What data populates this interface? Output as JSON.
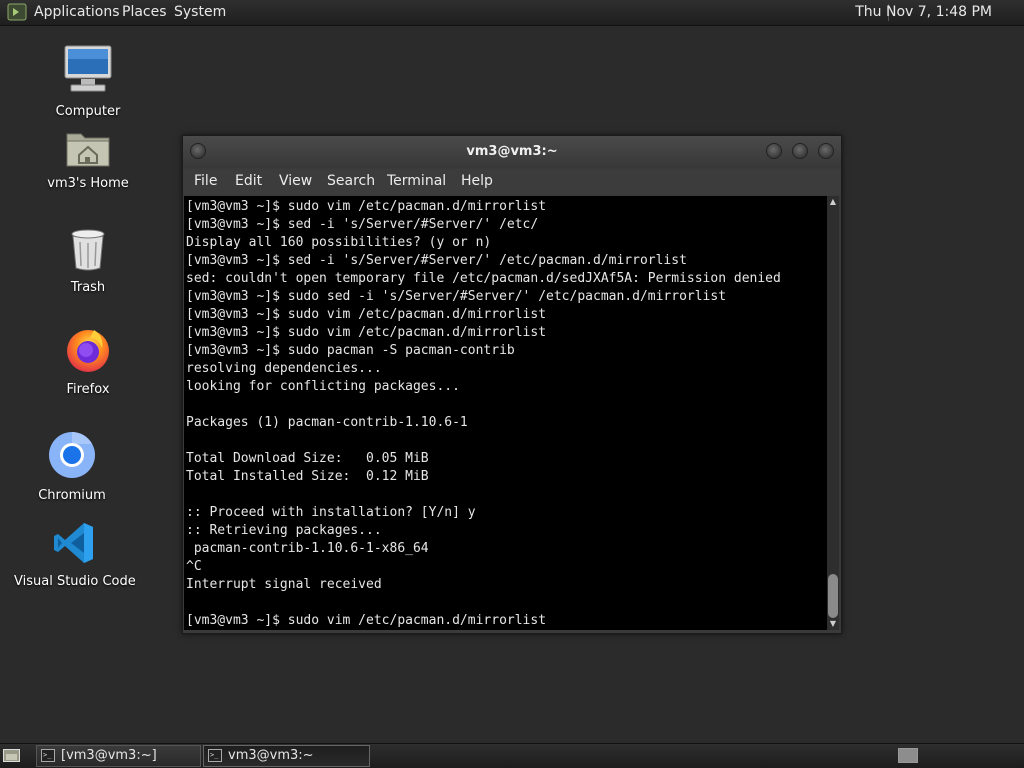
{
  "top_panel": {
    "menus": [
      "Applications",
      "Places",
      "System"
    ],
    "clock": "Thu Nov 7,  1:48 PM"
  },
  "desktop": {
    "icons": [
      {
        "label": "Computer",
        "icon": "computer-icon"
      },
      {
        "label": "vm3's Home",
        "icon": "home-folder-icon"
      },
      {
        "label": "Trash",
        "icon": "trash-icon"
      },
      {
        "label": "Firefox",
        "icon": "firefox-icon"
      },
      {
        "label": "Chromium",
        "icon": "chromium-icon"
      },
      {
        "label": "Visual Studio Code",
        "icon": "vscode-icon"
      }
    ]
  },
  "terminal": {
    "title": "vm3@vm3:~",
    "menu": [
      "File",
      "Edit",
      "View",
      "Search",
      "Terminal",
      "Help"
    ],
    "lines": [
      "[vm3@vm3 ~]$ sudo vim /etc/pacman.d/mirrorlist",
      "[vm3@vm3 ~]$ sed -i 's/Server/#Server/' /etc/",
      "Display all 160 possibilities? (y or n)",
      "[vm3@vm3 ~]$ sed -i 's/Server/#Server/' /etc/pacman.d/mirrorlist",
      "sed: couldn't open temporary file /etc/pacman.d/sedJXAf5A: Permission denied",
      "[vm3@vm3 ~]$ sudo sed -i 's/Server/#Server/' /etc/pacman.d/mirrorlist",
      "[vm3@vm3 ~]$ sudo vim /etc/pacman.d/mirrorlist",
      "[vm3@vm3 ~]$ sudo vim /etc/pacman.d/mirrorlist",
      "[vm3@vm3 ~]$ sudo pacman -S pacman-contrib",
      "resolving dependencies...",
      "looking for conflicting packages...",
      "",
      "Packages (1) pacman-contrib-1.10.6-1",
      "",
      "Total Download Size:   0.05 MiB",
      "Total Installed Size:  0.12 MiB",
      "",
      ":: Proceed with installation? [Y/n] y",
      ":: Retrieving packages...",
      " pacman-contrib-1.10.6-1-x86_64",
      "^C",
      "Interrupt signal received",
      "",
      "[vm3@vm3 ~]$ sudo vim /etc/pacman.d/mirrorlist"
    ]
  },
  "taskbar": {
    "tasks": [
      {
        "label": "[vm3@vm3:~]",
        "active": false
      },
      {
        "label": "vm3@vm3:~",
        "active": true
      }
    ]
  }
}
